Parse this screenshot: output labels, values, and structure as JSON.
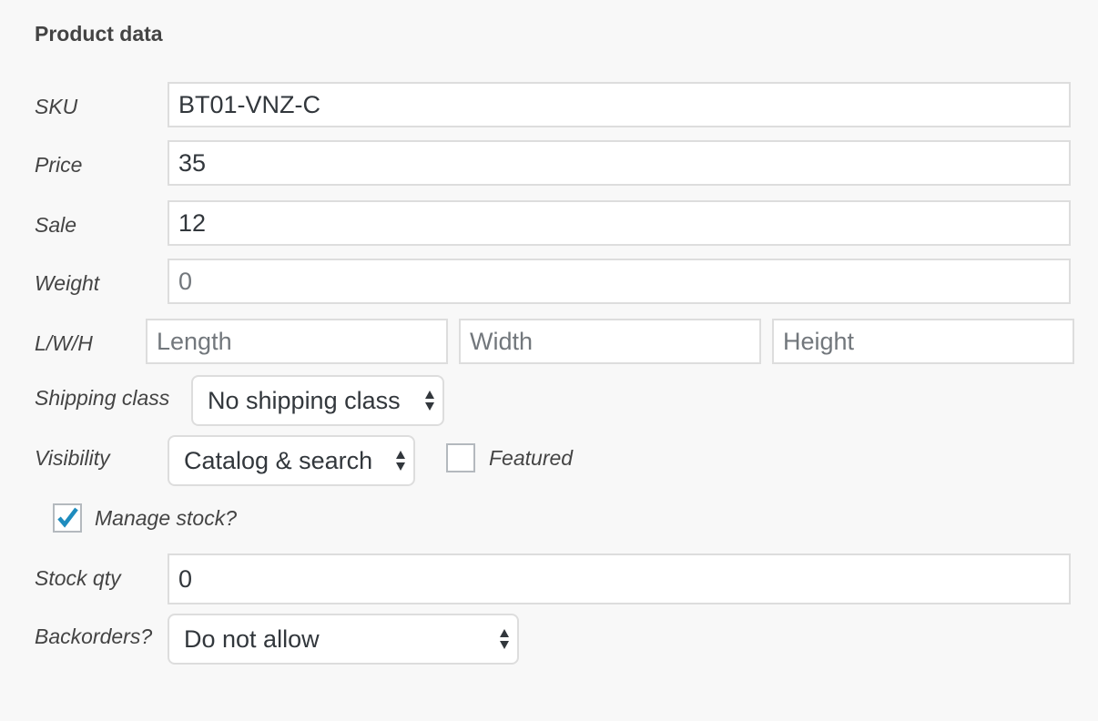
{
  "section": {
    "title": "Product data"
  },
  "fields": {
    "sku": {
      "label": "SKU",
      "value": "BT01-VNZ-C"
    },
    "price": {
      "label": "Price",
      "value": "35"
    },
    "sale": {
      "label": "Sale",
      "value": "12"
    },
    "weight": {
      "label": "Weight",
      "placeholder": "0"
    },
    "dimensions": {
      "label": "L/W/H",
      "length_placeholder": "Length",
      "width_placeholder": "Width",
      "height_placeholder": "Height"
    },
    "shipping_class": {
      "label": "Shipping class",
      "selected": "No shipping class"
    },
    "visibility": {
      "label": "Visibility",
      "selected": "Catalog & search"
    },
    "featured": {
      "label": "Featured",
      "checked": false
    },
    "manage_stock": {
      "label": "Manage stock?",
      "checked": true
    },
    "stock_qty": {
      "label": "Stock qty",
      "value": "0"
    },
    "backorders": {
      "label": "Backorders?",
      "selected": "Do not allow"
    }
  },
  "colors": {
    "checkmark": "#1e8cbe",
    "background": "#f8f8f8",
    "border": "#dddddd"
  }
}
